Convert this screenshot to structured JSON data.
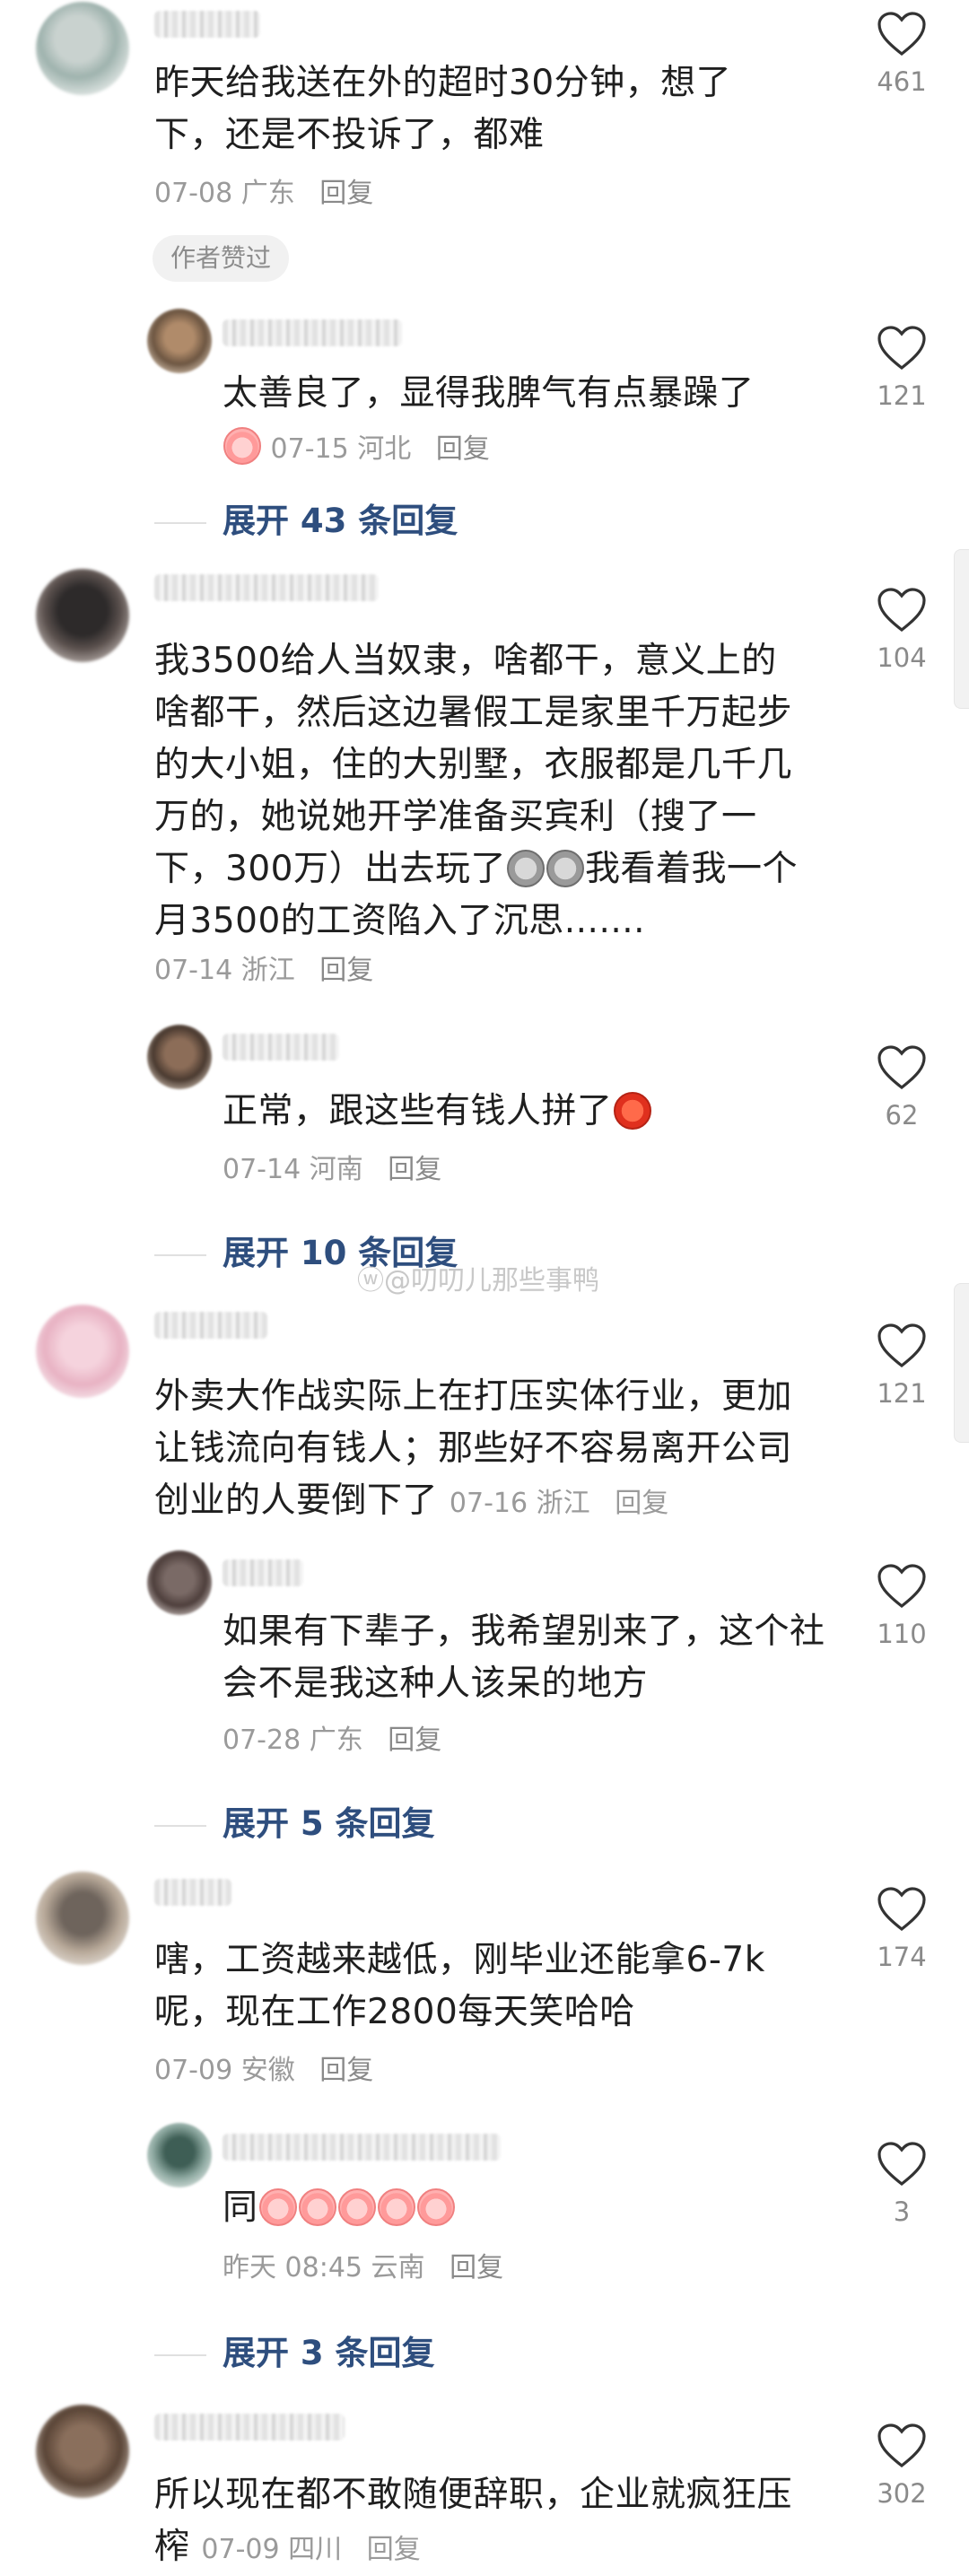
{
  "watermark": "ⓦ@叨叨儿那些事鸭",
  "comments": [
    {
      "text": "昨天给我送在外的超时30分钟，想了下，还是不投诉了，都难",
      "date": "07-08",
      "location": "广东",
      "reply_label": "回复",
      "likes": "461",
      "author_tag": "作者赞过",
      "replies": [
        {
          "text": "太善良了，显得我脾气有点暴躁了",
          "date": "07-15",
          "location": "河北",
          "reply_label": "回复",
          "likes": "121"
        }
      ],
      "expand_label": "展开 43 条回复"
    },
    {
      "text": "我3500给人当奴隶，啥都干，意义上的啥都干，然后这边暑假工是家里千万起步的大小姐，住的大别墅，衣服都是几千几万的，她说她开学准备买宾利（搜了一下，300万）出去玩了",
      "text_tail": "我看着我一个月3500的工资陷入了沉思.......",
      "date": "07-14",
      "location": "浙江",
      "reply_label": "回复",
      "likes": "104",
      "replies": [
        {
          "text": "正常，跟这些有钱人拼了",
          "date": "07-14",
          "location": "河南",
          "reply_label": "回复",
          "likes": "62"
        }
      ],
      "expand_label": "展开 10 条回复"
    },
    {
      "text": "外卖大作战实际上在打压实体行业，更加让钱流向有钱人；那些好不容易离开公司创业的人要倒下了",
      "date": "07-16",
      "location": "浙江",
      "reply_label": "回复",
      "likes": "121",
      "replies": [
        {
          "text": "如果有下辈子，我希望别来了，这个社会不是我这种人该呆的地方",
          "date": "07-28",
          "location": "广东",
          "reply_label": "回复",
          "likes": "110"
        }
      ],
      "expand_label": "展开 5 条回复"
    },
    {
      "text": "嗐，工资越来越低，刚毕业还能拿6-7k呢，现在工作2800每天笑哈哈",
      "date": "07-09",
      "location": "安徽",
      "reply_label": "回复",
      "likes": "174",
      "replies": [
        {
          "text": "同",
          "date": "昨天 08:45",
          "location": "云南",
          "reply_label": "回复",
          "likes": "3"
        }
      ],
      "expand_label": "展开 3 条回复"
    },
    {
      "text": "所以现在都不敢随便辞职，企业就疯狂压榨",
      "date": "07-09",
      "location": "四川",
      "reply_label": "回复",
      "likes": "302"
    }
  ]
}
